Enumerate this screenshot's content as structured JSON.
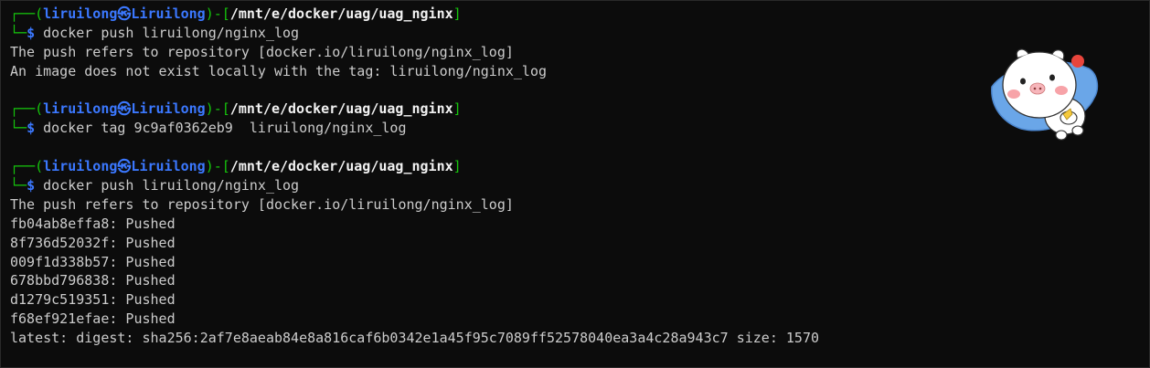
{
  "terminal": {
    "blocks": [
      {
        "prompt": {
          "top_left": "┌──(",
          "user": "liruilong",
          "sep": "㉿",
          "host": "Liruilong",
          "mid": ")-[",
          "path": "/mnt/e/docker/uag/uag_nginx",
          "end": "]",
          "bottom_left": "└─",
          "dollar": "$"
        },
        "command": "docker push liruilong/nginx_log",
        "output": [
          "The push refers to repository [docker.io/liruilong/nginx_log]",
          "An image does not exist locally with the tag: liruilong/nginx_log"
        ]
      },
      {
        "prompt": {
          "top_left": "┌──(",
          "user": "liruilong",
          "sep": "㉿",
          "host": "Liruilong",
          "mid": ")-[",
          "path": "/mnt/e/docker/uag/uag_nginx",
          "end": "]",
          "bottom_left": "└─",
          "dollar": "$"
        },
        "command": "docker tag 9c9af0362eb9  liruilong/nginx_log",
        "output": []
      },
      {
        "prompt": {
          "top_left": "┌──(",
          "user": "liruilong",
          "sep": "㉿",
          "host": "Liruilong",
          "mid": ")-[",
          "path": "/mnt/e/docker/uag/uag_nginx",
          "end": "]",
          "bottom_left": "└─",
          "dollar": "$"
        },
        "command": "docker push liruilong/nginx_log",
        "output": [
          "The push refers to repository [docker.io/liruilong/nginx_log]",
          "fb04ab8effa8: Pushed",
          "8f736d52032f: Pushed",
          "009f1d338b57: Pushed",
          "678bbd796838: Pushed",
          "d1279c519351: Pushed",
          "f68ef921efae: Pushed",
          "latest: digest: sha256:2af7e8aeab84e8a816caf6b0342e1a45f95c7089ff52578040ea3a4c28a943c7 size: 1570"
        ]
      }
    ]
  },
  "sticker": {
    "icon": "cartoon-pig-sticker-icon"
  },
  "colors": {
    "background": "#0c0c0c",
    "text": "#cccccc",
    "prompt_frame": "#16c60c",
    "user_host": "#3b78ff",
    "path": "#f2f2f2"
  }
}
